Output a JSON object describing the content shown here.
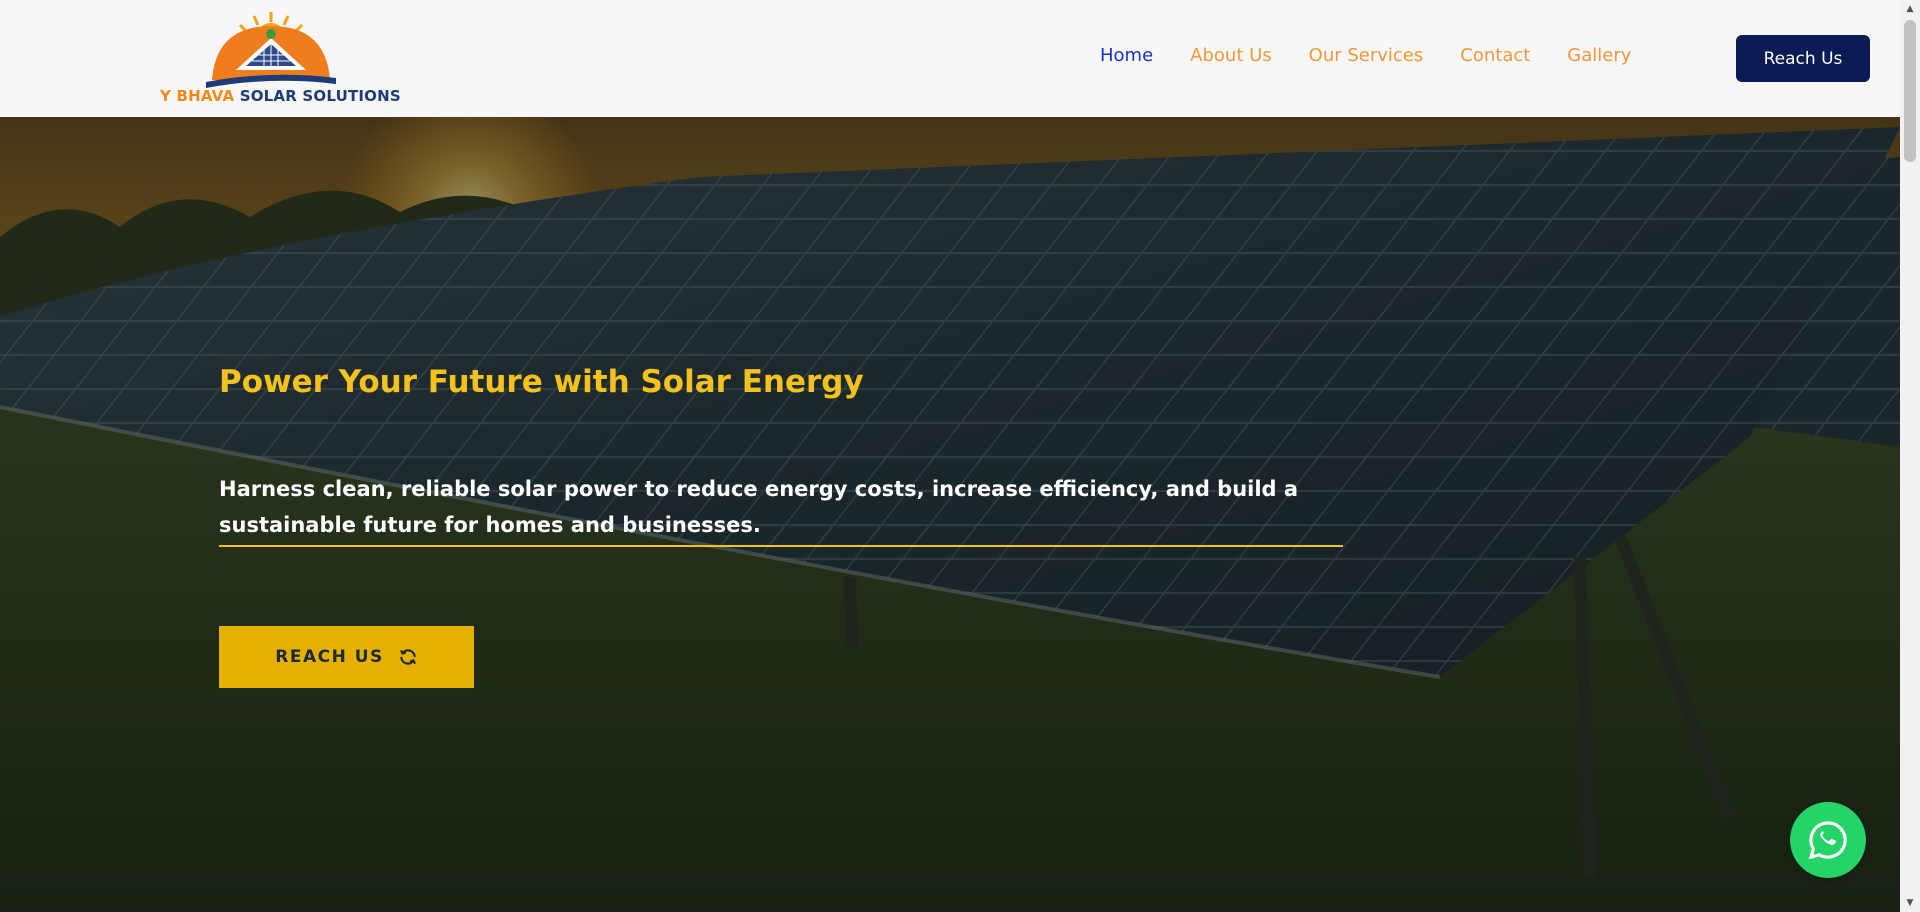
{
  "brand": {
    "name_part1": "Y BHAVA",
    "name_part2": "SOLAR SOLUTIONS"
  },
  "nav": {
    "items": [
      {
        "label": "Home",
        "active": true
      },
      {
        "label": "About Us",
        "active": false
      },
      {
        "label": "Our Services",
        "active": false
      },
      {
        "label": "Contact",
        "active": false
      },
      {
        "label": "Gallery",
        "active": false
      }
    ]
  },
  "header": {
    "reach_label": "Reach Us"
  },
  "hero": {
    "title": "Power Your Future with Solar Energy",
    "description": "Harness clean, reliable solar power to reduce energy costs, increase efficiency, and build a sustainable future for homes and businesses.",
    "cta_label": "REACH US",
    "cta_icon": "refresh-icon"
  },
  "floating": {
    "icon": "whatsapp-icon"
  },
  "colors": {
    "header_bg": "#f7f7f7",
    "nav_active": "#1a2fd0",
    "nav_link": "#f0983a",
    "reach_button_bg": "#0b1b55",
    "hero_title": "#f4c21c",
    "cta_bg": "#e6b000",
    "whatsapp": "#25d366"
  }
}
